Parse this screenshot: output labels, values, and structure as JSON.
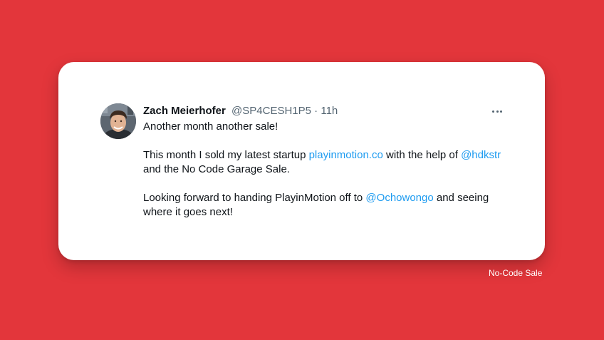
{
  "colors": {
    "background": "#e3363b",
    "card": "#ffffff",
    "link": "#1d9bf0",
    "text": "#0f1419",
    "muted": "#536471"
  },
  "tweet": {
    "avatar_icon": "profile-photo",
    "author_name": "Zach Meierhofer",
    "author_handle": "@SP4CESH1P5",
    "separator": "·",
    "time": "11h",
    "more_icon": "more-horizontal-icon",
    "line1": "Another month another sale!",
    "para2_part1": "This month I sold my latest startup ",
    "para2_link1": "playinmotion.co",
    "para2_part2": " with the help of ",
    "para2_mention1": "@hdkstr",
    "para2_part3": " and the No Code Garage Sale.",
    "para3_part1": "Looking forward to handing PlayinMotion off to ",
    "para3_mention": "@Ochowongo",
    "para3_part2": " and seeing where it goes next!"
  },
  "caption": "No-Code Sale"
}
